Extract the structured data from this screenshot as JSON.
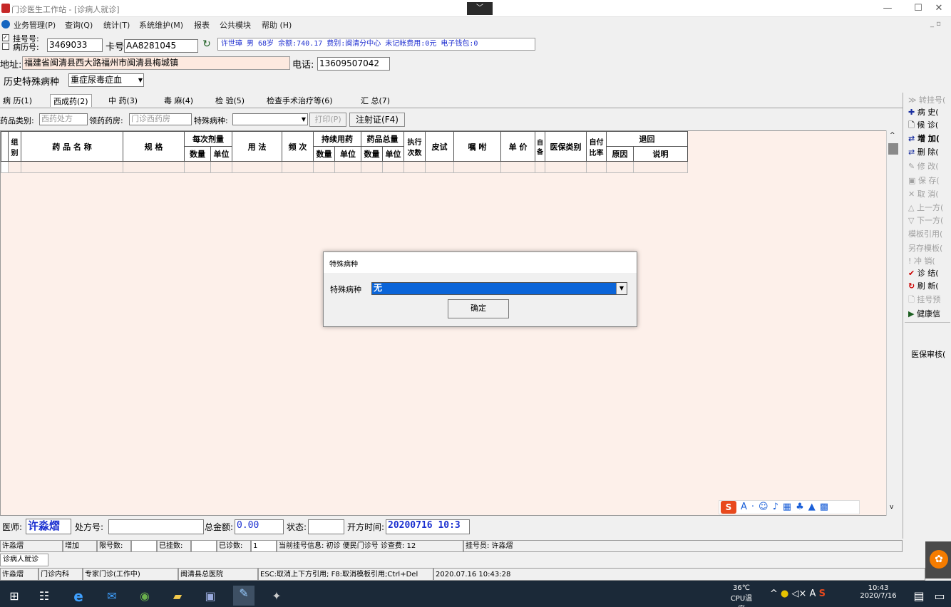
{
  "window": {
    "title": "门诊医生工作站 - [诊病人就诊]",
    "controls": [
      "—",
      "☐",
      "✕"
    ],
    "ime_tab": "﹀"
  },
  "menu": [
    "业务管理(P)",
    "查询(Q)",
    "统计(T)",
    "系统维护(M)",
    "报表",
    "公共模块",
    "帮助 (H)"
  ],
  "patient": {
    "reg_no_label": "挂号号:",
    "record_no_label": "病历号:",
    "record_no": "3469033",
    "card_label": "卡号",
    "card_no": "AA8281045",
    "info": "许世璋 男 68岁 余额:740.17 费别:闽清分中心 未记帐费用:0元 电子钱包:0",
    "address_label": "地址:",
    "address": "福建省闽清县西大路福州市闽清县梅城镇",
    "phone_label": "电话:",
    "phone": "13609507042",
    "history_label": "历史特殊病种",
    "history_value": "重症尿毒症血"
  },
  "tabs": [
    "病 历(1)",
    "西成药(2)",
    "中 药(3)",
    "毒 麻(4)",
    "检 验(5)",
    "检查手术治疗等(6)",
    "汇 总(7)"
  ],
  "drug_toolbar": {
    "category_label": "药品类别:",
    "category_value": "西药处方",
    "pharmacy_label": "领药药房:",
    "pharmacy_value": "门诊西药房",
    "disease_label": "特殊病种:",
    "print_btn": "打印(P)",
    "injection_btn": "注射证(F4)"
  },
  "grid_headers": {
    "group": "组别",
    "name": "药 品 名 称",
    "spec": "规 格",
    "per_dose": "每次剂量",
    "qty": "数量",
    "unit": "单位",
    "usage": "用 法",
    "freq": "频 次",
    "continuous": "持续用药",
    "total": "药品总量",
    "exec_times": "执行次数",
    "skin_test": "皮试",
    "instructions": "嘱 咐",
    "price": "单 价",
    "self_prep": "自备",
    "ins_type": "医保类别",
    "self_ratio": "自付比率",
    "return": "退回",
    "reason": "原因",
    "note": "说明"
  },
  "side_buttons": [
    {
      "label": "转挂号(",
      "icon": "≫",
      "enabled": false
    },
    {
      "label": "病 史(",
      "icon": "✚",
      "enabled": true
    },
    {
      "label": "候 诊(",
      "icon": "🗋",
      "enabled": true
    },
    {
      "label": "增 加(",
      "icon": "⇄",
      "enabled": true
    },
    {
      "label": "删 除(",
      "icon": "⇄",
      "enabled": true
    },
    {
      "label": "修 改(",
      "icon": "✎",
      "enabled": false
    },
    {
      "label": "保 存(",
      "icon": "▣",
      "enabled": false
    },
    {
      "label": "取 消(",
      "icon": "✕",
      "enabled": false
    },
    {
      "label": "上一方(",
      "icon": "△",
      "enabled": false
    },
    {
      "label": "下一方(",
      "icon": "▽",
      "enabled": false
    },
    {
      "label": "模板引用(",
      "icon": "",
      "enabled": false
    },
    {
      "label": "另存模板(",
      "icon": "",
      "enabled": false
    },
    {
      "label": "冲 销(",
      "icon": "!",
      "enabled": false
    },
    {
      "label": "诊 结(",
      "icon": "✔",
      "enabled": true
    },
    {
      "label": "刷 新(",
      "icon": "↻",
      "enabled": true
    },
    {
      "label": "挂号预",
      "icon": "🗋",
      "enabled": false
    },
    {
      "label": "健康信",
      "icon": "▶",
      "enabled": true
    },
    {
      "label": "医保审核(",
      "icon": "",
      "enabled": true
    }
  ],
  "footer": {
    "doctor_label": "医师:",
    "doctor": "许淼熠",
    "rx_label": "处方号:",
    "total_label": "总金额:",
    "total": "0.00",
    "status_label": "状态:",
    "open_time_label": "开方时间:",
    "open_time": "20200716 10:3"
  },
  "status_row1": [
    "许淼熠",
    "增加",
    "限号数:",
    "",
    "已挂数:",
    "",
    "已诊数:",
    "1",
    "当前挂号信息: 初诊 便民门诊号 诊查费: 12",
    "挂号员: 许淼熠"
  ],
  "status_row2": "诊病人就诊",
  "status_row3": [
    "许淼熠",
    "门诊内科",
    "专家门诊(工作中)",
    "闽清县总医院",
    "ESC:取消上下方引用; F8:取消模板引用;Ctrl+Del",
    "2020.07.16 10:43:28"
  ],
  "dialog": {
    "title": "特殊病种",
    "field_label": "特殊病种",
    "field_value": "无",
    "ok_button": "确定"
  },
  "taskbar": {
    "temp": "36℃",
    "temp_label": "CPU温度",
    "time": "10:43",
    "date": "2020/7/16"
  }
}
